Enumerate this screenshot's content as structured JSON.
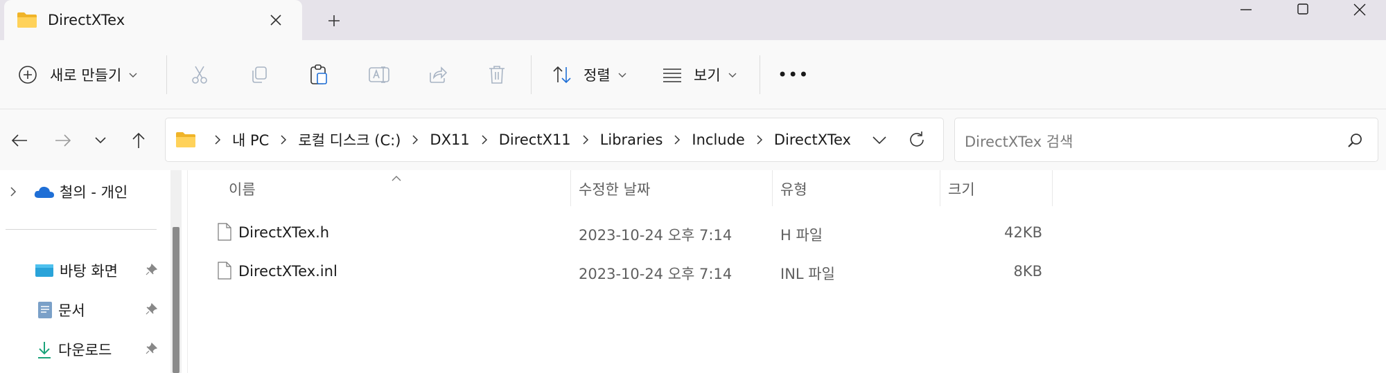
{
  "window": {
    "tab_title": "DirectXTex",
    "folder_color": "#f6c343"
  },
  "toolbar": {
    "new_label": "새로 만들기",
    "sort_label": "정렬",
    "view_label": "보기",
    "more_label": "•••"
  },
  "address": {
    "crumbs": [
      "내 PC",
      "로컬 디스크 (C:)",
      "DX11",
      "DirectX11",
      "Libraries",
      "Include",
      "DirectXTex"
    ]
  },
  "search": {
    "placeholder": "DirectXTex 검색"
  },
  "nav": {
    "onedrive_label": "철의 - 개인",
    "items": [
      {
        "label": "바탕 화면"
      },
      {
        "label": "문서"
      },
      {
        "label": "다운로드"
      }
    ]
  },
  "columns": {
    "name": "이름",
    "date": "수정한 날짜",
    "type": "유형",
    "size": "크기"
  },
  "files": [
    {
      "name": "DirectXTex.h",
      "date": "2023-10-24 오후 7:14",
      "type": "H 파일",
      "size": "42KB"
    },
    {
      "name": "DirectXTex.inl",
      "date": "2023-10-24 오후 7:14",
      "type": "INL 파일",
      "size": "8KB"
    }
  ],
  "colors": {
    "titlebar_bg": "#e6e3ea",
    "accent_blue": "#0067c0",
    "onedrive": "#1f6fd6"
  }
}
